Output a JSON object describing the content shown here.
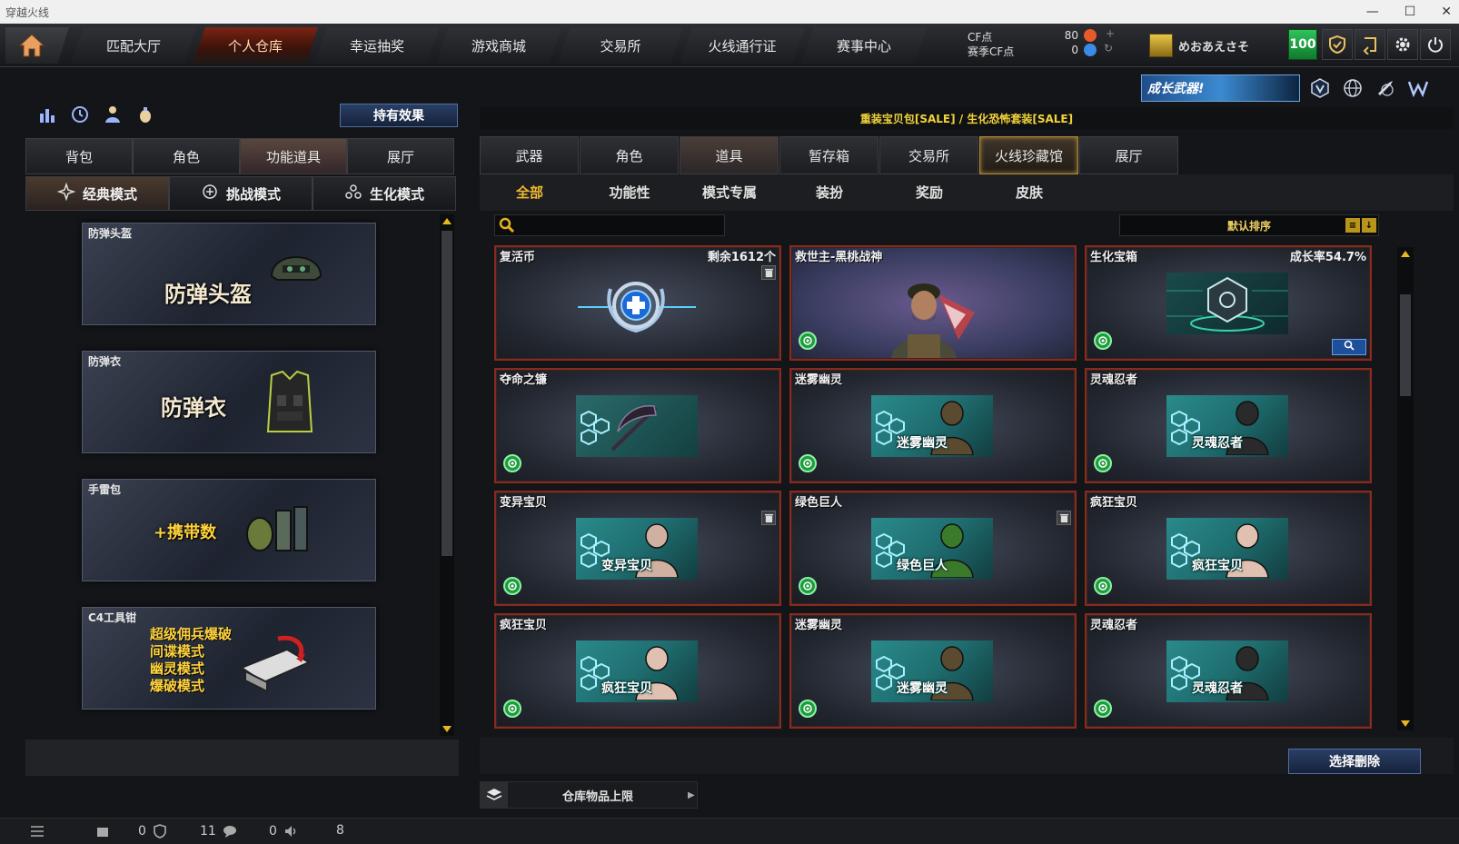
{
  "window": {
    "title": "穿越火线"
  },
  "nav": {
    "tabs": [
      "匹配大厅",
      "个人仓库",
      "幸运抽奖",
      "游戏商城",
      "交易所",
      "火线通行证",
      "赛事中心"
    ],
    "active_index": 1
  },
  "currency": {
    "cf_label": "CF点",
    "cf_value": "80",
    "match_cf_label": "赛季CF点",
    "match_cf_value": "0"
  },
  "user": {
    "name": "めおあえさそ",
    "level": "100"
  },
  "promo": {
    "text": "成长武器!"
  },
  "left": {
    "hold_effect_label": "持有效果",
    "tabs": [
      "背包",
      "角色",
      "功能道具",
      "展厅"
    ],
    "active_tab": 2,
    "modes": [
      "经典模式",
      "挑战模式",
      "生化模式"
    ],
    "active_mode": 0,
    "items": [
      {
        "title": "防弹头盔",
        "big": "防弹头盔"
      },
      {
        "title": "防弹衣",
        "big": "防弹衣"
      },
      {
        "title": "手雷包",
        "big": "+携带数"
      },
      {
        "title": "C4工具钳",
        "lines": [
          "超级佣兵爆破",
          "间谍模式",
          "幽灵模式",
          "爆破模式"
        ]
      }
    ]
  },
  "right": {
    "header": "重装宝贝包[SALE] / 生化恐怖套装[SALE]",
    "tabs": [
      "武器",
      "角色",
      "道具",
      "暂存箱",
      "交易所",
      "火线珍藏馆",
      "展厅"
    ],
    "active_tab": 2,
    "gold_tab": 5,
    "sub_tabs": [
      "全部",
      "功能性",
      "模式专属",
      "装扮",
      "奖励",
      "皮肤"
    ],
    "active_sub": 0,
    "search_placeholder": "",
    "sort_label": "默认排序",
    "items": [
      {
        "title": "复活币",
        "extra": "剩余1612个",
        "kind": "revive",
        "trash": true,
        "lock": false
      },
      {
        "title": "救世主-黑桃战神",
        "extra": "",
        "kind": "soldier",
        "trash": false,
        "lock": true
      },
      {
        "title": "生化宝箱",
        "extra": "成长率54.7%",
        "kind": "box",
        "trash": false,
        "lock": true,
        "mag": true
      },
      {
        "title": "夺命之镰",
        "extra": "",
        "kind": "scythe",
        "trash": false,
        "lock": true
      },
      {
        "title": "迷雾幽灵",
        "extra": "",
        "kind": "zombie",
        "label": "迷雾幽灵",
        "trash": false,
        "lock": true
      },
      {
        "title": "灵魂忍者",
        "extra": "",
        "kind": "zombie",
        "label": "灵魂忍者",
        "trash": false,
        "lock": true
      },
      {
        "title": "变异宝贝",
        "extra": "",
        "kind": "zombie",
        "label": "变异宝贝",
        "trash": true,
        "lock": true
      },
      {
        "title": "绿色巨人",
        "extra": "",
        "kind": "zombie",
        "label": "绿色巨人",
        "trash": true,
        "lock": true
      },
      {
        "title": "疯狂宝贝",
        "extra": "",
        "kind": "zombie",
        "label": "疯狂宝贝",
        "trash": false,
        "lock": true
      },
      {
        "title": "疯狂宝贝",
        "extra": "",
        "kind": "zombie",
        "label": "疯狂宝贝",
        "trash": false,
        "lock": true
      },
      {
        "title": "迷雾幽灵",
        "extra": "",
        "kind": "zombie",
        "label": "迷雾幽灵",
        "trash": false,
        "lock": true
      },
      {
        "title": "灵魂忍者",
        "extra": "",
        "kind": "zombie",
        "label": "灵魂忍者",
        "trash": false,
        "lock": true
      }
    ],
    "select_delete_label": "选择删除",
    "storage_label": "仓库物品上限"
  },
  "status": {
    "mail": "0",
    "shield": "11",
    "chat": "0",
    "volume": "8"
  },
  "colors": {
    "accent_red": "#8a2a1e",
    "gold": "#f0b830",
    "level_green": "#2fc35a"
  }
}
